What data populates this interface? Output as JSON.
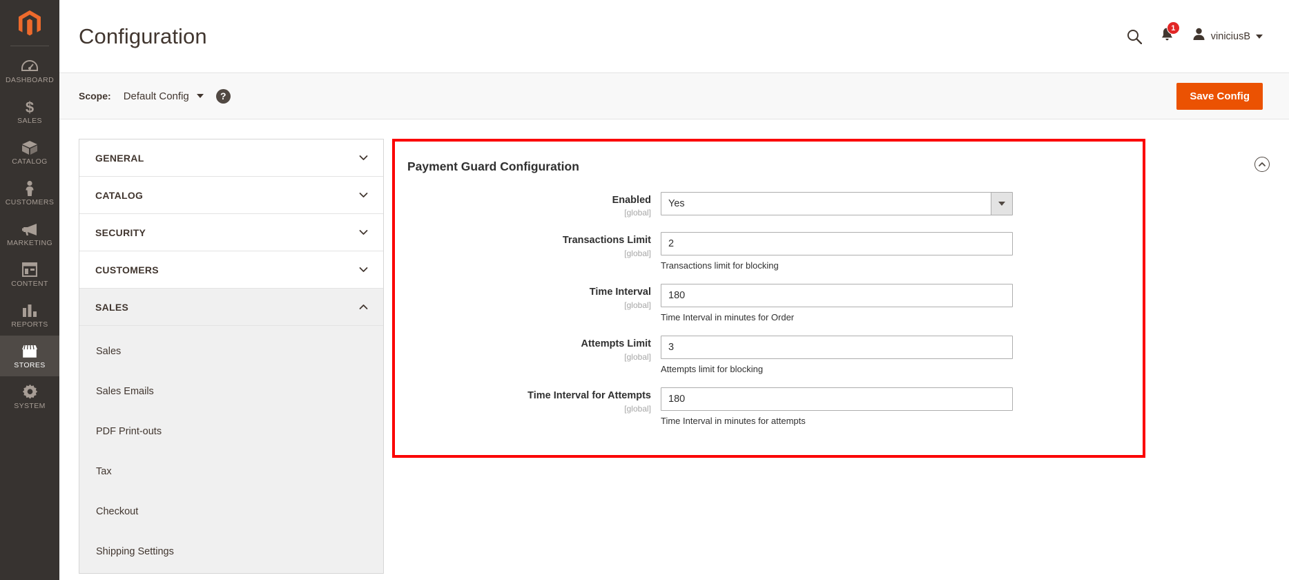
{
  "rail": {
    "logo_icon": "magento-logo-icon",
    "items": [
      {
        "label": "DASHBOARD",
        "icon": "dashboard-icon",
        "active": false
      },
      {
        "label": "SALES",
        "icon": "dollar-icon",
        "active": false
      },
      {
        "label": "CATALOG",
        "icon": "box-icon",
        "active": false
      },
      {
        "label": "CUSTOMERS",
        "icon": "person-icon",
        "active": false
      },
      {
        "label": "MARKETING",
        "icon": "megaphone-icon",
        "active": false
      },
      {
        "label": "CONTENT",
        "icon": "layout-icon",
        "active": false
      },
      {
        "label": "REPORTS",
        "icon": "bar-chart-icon",
        "active": false
      },
      {
        "label": "STORES",
        "icon": "store-icon",
        "active": true
      },
      {
        "label": "SYSTEM",
        "icon": "gear-icon",
        "active": false
      }
    ]
  },
  "header": {
    "title": "Configuration",
    "search_icon": "search-icon",
    "notifications_icon": "bell-icon",
    "notifications_count": "1",
    "user_icon": "user-avatar-icon",
    "user_name": "viniciusB"
  },
  "scope_bar": {
    "label": "Scope:",
    "value": "Default Config",
    "help_icon": "question-mark-icon",
    "help_glyph": "?",
    "save_label": "Save Config",
    "save_color": "#eb5202"
  },
  "nav": {
    "sections": [
      {
        "title": "GENERAL",
        "open": false,
        "subs": []
      },
      {
        "title": "CATALOG",
        "open": false,
        "subs": []
      },
      {
        "title": "SECURITY",
        "open": false,
        "subs": []
      },
      {
        "title": "CUSTOMERS",
        "open": false,
        "subs": []
      },
      {
        "title": "SALES",
        "open": true,
        "subs": [
          {
            "label": "Sales"
          },
          {
            "label": "Sales Emails"
          },
          {
            "label": "PDF Print-outs"
          },
          {
            "label": "Tax"
          },
          {
            "label": "Checkout"
          },
          {
            "label": "Shipping Settings"
          }
        ]
      }
    ]
  },
  "panel": {
    "title": "Payment Guard Configuration",
    "highlight_color": "#fb0000",
    "collapse_icon": "chevron-up-circle-icon",
    "scope_tag": "[global]",
    "fields": [
      {
        "label": "Enabled",
        "scope": "[global]",
        "type": "select",
        "value": "Yes",
        "hint": ""
      },
      {
        "label": "Transactions Limit",
        "scope": "[global]",
        "type": "text",
        "value": "2",
        "hint": "Transactions limit for blocking"
      },
      {
        "label": "Time Interval",
        "scope": "[global]",
        "type": "text",
        "value": "180",
        "hint": "Time Interval in minutes for Order"
      },
      {
        "label": "Attempts Limit",
        "scope": "[global]",
        "type": "text",
        "value": "3",
        "hint": "Attempts limit for blocking"
      },
      {
        "label": "Time Interval for Attempts",
        "scope": "[global]",
        "type": "text",
        "value": "180",
        "hint": "Time Interval in minutes for attempts"
      }
    ]
  }
}
